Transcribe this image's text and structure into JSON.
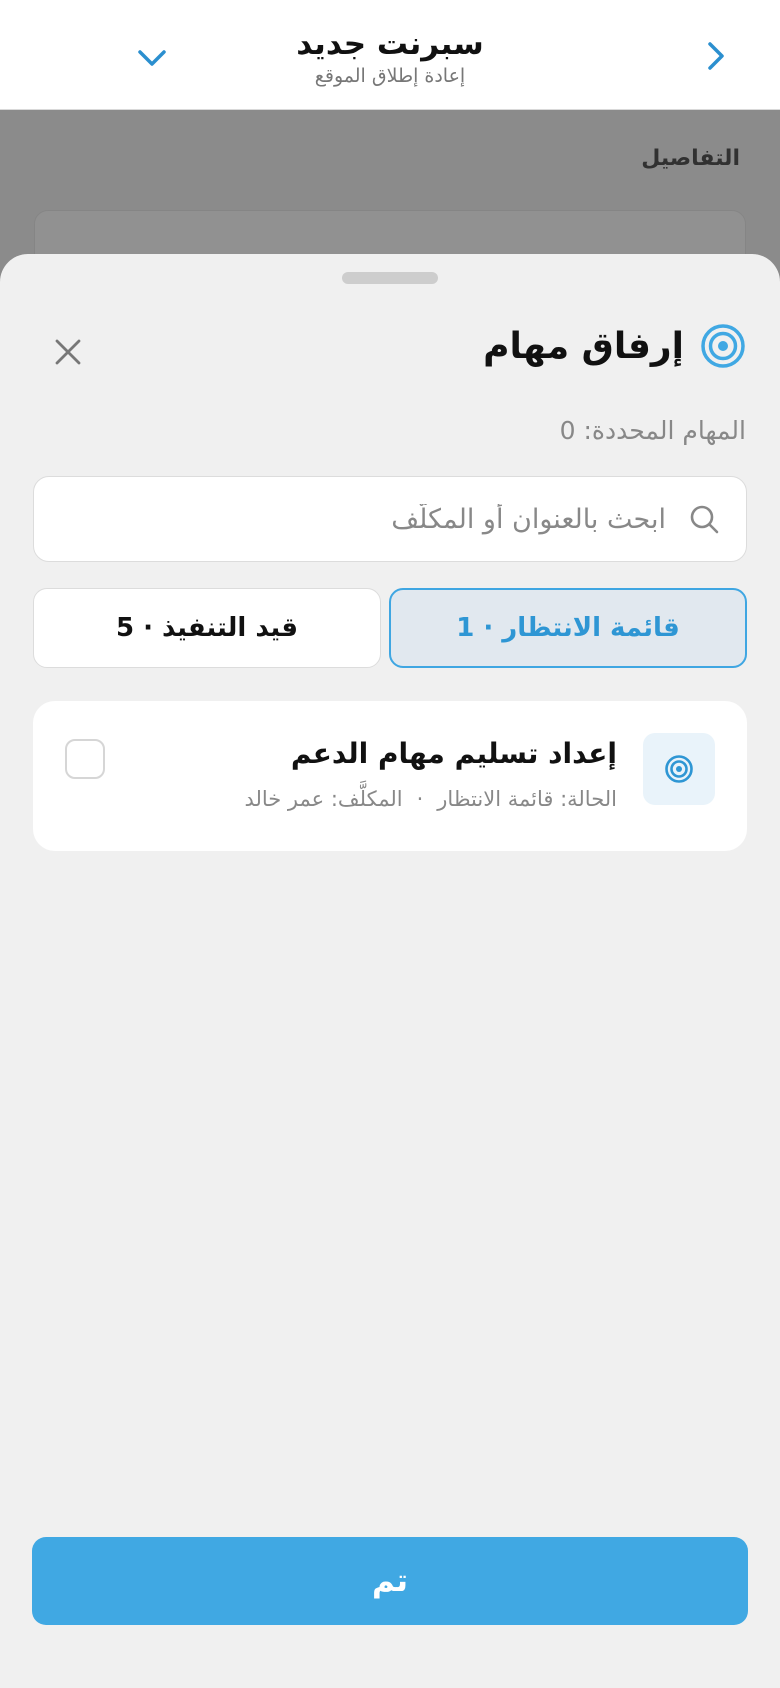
{
  "header": {
    "title": "سبرنت جديد",
    "subtitle": "إعادة إطلاق الموقع",
    "back_icon": "chevron-right-icon",
    "dropdown_icon": "chevron-down-icon"
  },
  "background": {
    "details_label": "التفاصيل"
  },
  "sheet": {
    "title": "إرفاق مهام",
    "title_icon": "target-icon",
    "close_icon": "close-icon",
    "selected_count": "المهام المحددة: 0",
    "search": {
      "placeholder": "ابحث بالعنوان أو المكلَّف",
      "value": ""
    },
    "tabs": [
      {
        "label": "قائمة الانتظار · 1",
        "active": true
      },
      {
        "label": "قيد التنفيذ · 5",
        "active": false
      }
    ],
    "tasks": [
      {
        "title": "إعداد تسليم مهام الدعم",
        "status": "الحالة: قائمة الانتظار",
        "separator": "·",
        "assignee": "المكلَّف: عمر خالد",
        "checked": false
      }
    ],
    "done_label": "تم"
  },
  "colors": {
    "accent": "#40a8e3",
    "accent_text": "#2e96d4",
    "tab_active_bg": "#e1e8ef",
    "sheet_bg": "#f0f0f0"
  }
}
